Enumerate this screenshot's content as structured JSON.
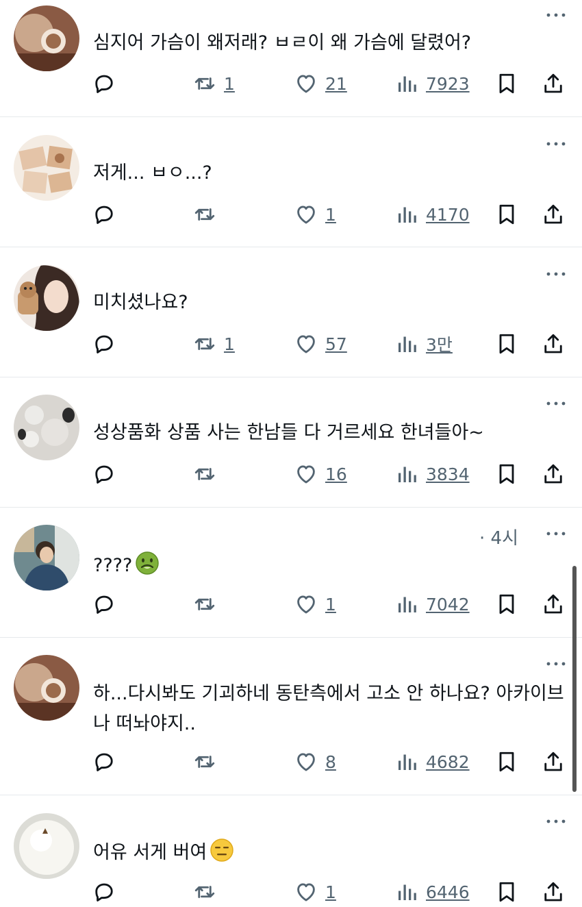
{
  "tweets": [
    {
      "text": "심지어 가슴이 왜저래? ㅂㄹ이 왜 가슴에 달렸어?",
      "meta": "",
      "emoji": "",
      "retweets": "1",
      "likes": "21",
      "views": "7923"
    },
    {
      "text": "저게... ㅂㅇ...?",
      "meta": "",
      "emoji": "",
      "retweets": "",
      "likes": "1",
      "views": "4170"
    },
    {
      "text": "미치셨나요?",
      "meta": "",
      "emoji": "",
      "retweets": "1",
      "likes": "57",
      "views": "3만"
    },
    {
      "text": "성상품화 상품 사는 한남들 다 거르세요 한녀들아~",
      "meta": "",
      "emoji": "",
      "retweets": "",
      "likes": "16",
      "views": "3834"
    },
    {
      "text": "????",
      "meta": "· 4시",
      "emoji": "nauseated-face-emoji",
      "retweets": "",
      "likes": "1",
      "views": "7042"
    },
    {
      "text": "하...다시봐도 기괴하네 동탄측에서 고소 안 하나요? 아카이브나 떠놔야지..",
      "meta": "",
      "emoji": "",
      "retweets": "",
      "likes": "8",
      "views": "4682"
    },
    {
      "text": "어유 서게 버여",
      "meta": "",
      "emoji": "expressionless-face-emoji",
      "retweets": "",
      "likes": "1",
      "views": "6446"
    }
  ],
  "icons": {
    "reply": "reply-icon",
    "retweet": "retweet-icon",
    "like": "heart-icon",
    "views": "views-chart-icon",
    "bookmark": "bookmark-icon",
    "share": "share-icon",
    "more": "more-dots-icon"
  },
  "colors": {
    "text": "#0f1419",
    "secondary": "#536471",
    "divider": "#e6e9ec"
  }
}
